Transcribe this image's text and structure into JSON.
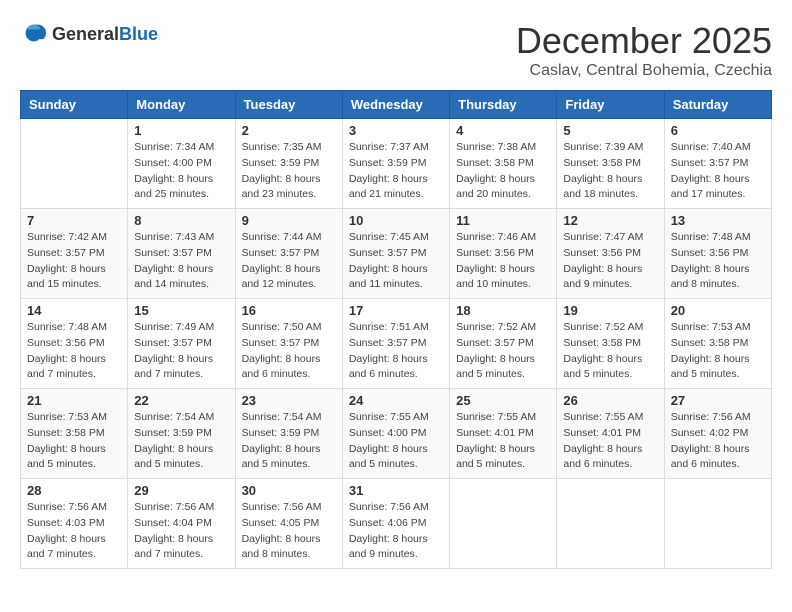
{
  "logo": {
    "general": "General",
    "blue": "Blue"
  },
  "header": {
    "month": "December 2025",
    "location": "Caslav, Central Bohemia, Czechia"
  },
  "weekdays": [
    "Sunday",
    "Monday",
    "Tuesday",
    "Wednesday",
    "Thursday",
    "Friday",
    "Saturday"
  ],
  "weeks": [
    [
      {
        "day": "",
        "sunrise": "",
        "sunset": "",
        "daylight": ""
      },
      {
        "day": "1",
        "sunrise": "Sunrise: 7:34 AM",
        "sunset": "Sunset: 4:00 PM",
        "daylight": "Daylight: 8 hours and 25 minutes."
      },
      {
        "day": "2",
        "sunrise": "Sunrise: 7:35 AM",
        "sunset": "Sunset: 3:59 PM",
        "daylight": "Daylight: 8 hours and 23 minutes."
      },
      {
        "day": "3",
        "sunrise": "Sunrise: 7:37 AM",
        "sunset": "Sunset: 3:59 PM",
        "daylight": "Daylight: 8 hours and 21 minutes."
      },
      {
        "day": "4",
        "sunrise": "Sunrise: 7:38 AM",
        "sunset": "Sunset: 3:58 PM",
        "daylight": "Daylight: 8 hours and 20 minutes."
      },
      {
        "day": "5",
        "sunrise": "Sunrise: 7:39 AM",
        "sunset": "Sunset: 3:58 PM",
        "daylight": "Daylight: 8 hours and 18 minutes."
      },
      {
        "day": "6",
        "sunrise": "Sunrise: 7:40 AM",
        "sunset": "Sunset: 3:57 PM",
        "daylight": "Daylight: 8 hours and 17 minutes."
      }
    ],
    [
      {
        "day": "7",
        "sunrise": "Sunrise: 7:42 AM",
        "sunset": "Sunset: 3:57 PM",
        "daylight": "Daylight: 8 hours and 15 minutes."
      },
      {
        "day": "8",
        "sunrise": "Sunrise: 7:43 AM",
        "sunset": "Sunset: 3:57 PM",
        "daylight": "Daylight: 8 hours and 14 minutes."
      },
      {
        "day": "9",
        "sunrise": "Sunrise: 7:44 AM",
        "sunset": "Sunset: 3:57 PM",
        "daylight": "Daylight: 8 hours and 12 minutes."
      },
      {
        "day": "10",
        "sunrise": "Sunrise: 7:45 AM",
        "sunset": "Sunset: 3:57 PM",
        "daylight": "Daylight: 8 hours and 11 minutes."
      },
      {
        "day": "11",
        "sunrise": "Sunrise: 7:46 AM",
        "sunset": "Sunset: 3:56 PM",
        "daylight": "Daylight: 8 hours and 10 minutes."
      },
      {
        "day": "12",
        "sunrise": "Sunrise: 7:47 AM",
        "sunset": "Sunset: 3:56 PM",
        "daylight": "Daylight: 8 hours and 9 minutes."
      },
      {
        "day": "13",
        "sunrise": "Sunrise: 7:48 AM",
        "sunset": "Sunset: 3:56 PM",
        "daylight": "Daylight: 8 hours and 8 minutes."
      }
    ],
    [
      {
        "day": "14",
        "sunrise": "Sunrise: 7:48 AM",
        "sunset": "Sunset: 3:56 PM",
        "daylight": "Daylight: 8 hours and 7 minutes."
      },
      {
        "day": "15",
        "sunrise": "Sunrise: 7:49 AM",
        "sunset": "Sunset: 3:57 PM",
        "daylight": "Daylight: 8 hours and 7 minutes."
      },
      {
        "day": "16",
        "sunrise": "Sunrise: 7:50 AM",
        "sunset": "Sunset: 3:57 PM",
        "daylight": "Daylight: 8 hours and 6 minutes."
      },
      {
        "day": "17",
        "sunrise": "Sunrise: 7:51 AM",
        "sunset": "Sunset: 3:57 PM",
        "daylight": "Daylight: 8 hours and 6 minutes."
      },
      {
        "day": "18",
        "sunrise": "Sunrise: 7:52 AM",
        "sunset": "Sunset: 3:57 PM",
        "daylight": "Daylight: 8 hours and 5 minutes."
      },
      {
        "day": "19",
        "sunrise": "Sunrise: 7:52 AM",
        "sunset": "Sunset: 3:58 PM",
        "daylight": "Daylight: 8 hours and 5 minutes."
      },
      {
        "day": "20",
        "sunrise": "Sunrise: 7:53 AM",
        "sunset": "Sunset: 3:58 PM",
        "daylight": "Daylight: 8 hours and 5 minutes."
      }
    ],
    [
      {
        "day": "21",
        "sunrise": "Sunrise: 7:53 AM",
        "sunset": "Sunset: 3:58 PM",
        "daylight": "Daylight: 8 hours and 5 minutes."
      },
      {
        "day": "22",
        "sunrise": "Sunrise: 7:54 AM",
        "sunset": "Sunset: 3:59 PM",
        "daylight": "Daylight: 8 hours and 5 minutes."
      },
      {
        "day": "23",
        "sunrise": "Sunrise: 7:54 AM",
        "sunset": "Sunset: 3:59 PM",
        "daylight": "Daylight: 8 hours and 5 minutes."
      },
      {
        "day": "24",
        "sunrise": "Sunrise: 7:55 AM",
        "sunset": "Sunset: 4:00 PM",
        "daylight": "Daylight: 8 hours and 5 minutes."
      },
      {
        "day": "25",
        "sunrise": "Sunrise: 7:55 AM",
        "sunset": "Sunset: 4:01 PM",
        "daylight": "Daylight: 8 hours and 5 minutes."
      },
      {
        "day": "26",
        "sunrise": "Sunrise: 7:55 AM",
        "sunset": "Sunset: 4:01 PM",
        "daylight": "Daylight: 8 hours and 6 minutes."
      },
      {
        "day": "27",
        "sunrise": "Sunrise: 7:56 AM",
        "sunset": "Sunset: 4:02 PM",
        "daylight": "Daylight: 8 hours and 6 minutes."
      }
    ],
    [
      {
        "day": "28",
        "sunrise": "Sunrise: 7:56 AM",
        "sunset": "Sunset: 4:03 PM",
        "daylight": "Daylight: 8 hours and 7 minutes."
      },
      {
        "day": "29",
        "sunrise": "Sunrise: 7:56 AM",
        "sunset": "Sunset: 4:04 PM",
        "daylight": "Daylight: 8 hours and 7 minutes."
      },
      {
        "day": "30",
        "sunrise": "Sunrise: 7:56 AM",
        "sunset": "Sunset: 4:05 PM",
        "daylight": "Daylight: 8 hours and 8 minutes."
      },
      {
        "day": "31",
        "sunrise": "Sunrise: 7:56 AM",
        "sunset": "Sunset: 4:06 PM",
        "daylight": "Daylight: 8 hours and 9 minutes."
      },
      {
        "day": "",
        "sunrise": "",
        "sunset": "",
        "daylight": ""
      },
      {
        "day": "",
        "sunrise": "",
        "sunset": "",
        "daylight": ""
      },
      {
        "day": "",
        "sunrise": "",
        "sunset": "",
        "daylight": ""
      }
    ]
  ]
}
